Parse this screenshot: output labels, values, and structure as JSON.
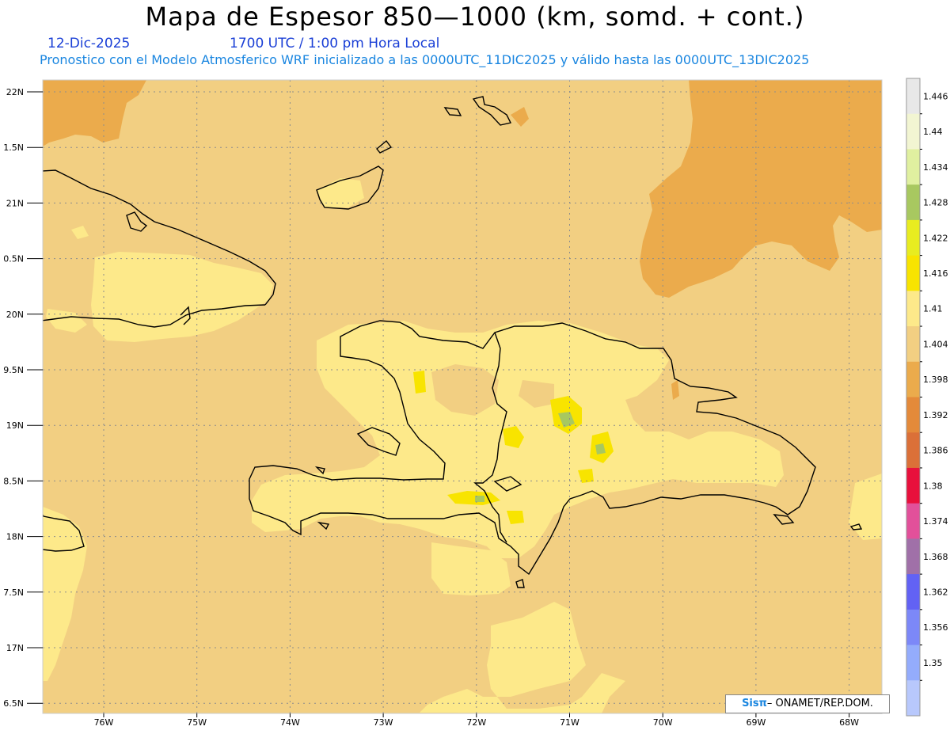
{
  "header": {
    "title": "Mapa de Espesor 850—1000 (km, somd. + cont.)",
    "date": "12-Dic-2025",
    "time": "1700 UTC / 1:00 pm Hora Local",
    "subtitle": "Pronostico con el Modelo Atmosferico WRF inicializado a las 0000UTC_11DIC2025 y válido hasta las  0000UTC_13DIC2025"
  },
  "axes": {
    "lat_labels": [
      "22N",
      "1.5N",
      "21N",
      "0.5N",
      "20N",
      "9.5N",
      "19N",
      "8.5N",
      "18N",
      "7.5N",
      "17N",
      "6.5N"
    ],
    "lon_labels": [
      "76W",
      "75W",
      "74W",
      "73W",
      "72W",
      "71W",
      "70W",
      "69W",
      "68W"
    ]
  },
  "colorbar": {
    "labels": [
      "1.446",
      "1.44",
      "1.434",
      "1.428",
      "1.422",
      "1.416",
      "1.41",
      "1.404",
      "1.398",
      "1.392",
      "1.386",
      "1.38",
      "1.374",
      "1.368",
      "1.362",
      "1.356",
      "1.35"
    ],
    "colors": [
      "#e8e8e8",
      "#f2f5d2",
      "#e0f0a0",
      "#a8c860",
      "#e8ec20",
      "#f8e400",
      "#fde98a",
      "#f2cf82",
      "#ebab4c",
      "#e48a3a",
      "#db7038",
      "#e8103c",
      "#e2509a",
      "#a070a8",
      "#6262f4",
      "#7c88f8",
      "#94acfc",
      "#b8c8fc"
    ]
  },
  "credit": {
    "logo": "Sisπ",
    "text": "– ONAMET/REP.DOM."
  },
  "colors": {
    "base": "#f2cf82",
    "light": "#fde98a",
    "orange": "#ebab4c",
    "yellow": "#f8e400",
    "green": "#a8c860",
    "coast": "#000000",
    "grid": "#8c8c8c"
  }
}
